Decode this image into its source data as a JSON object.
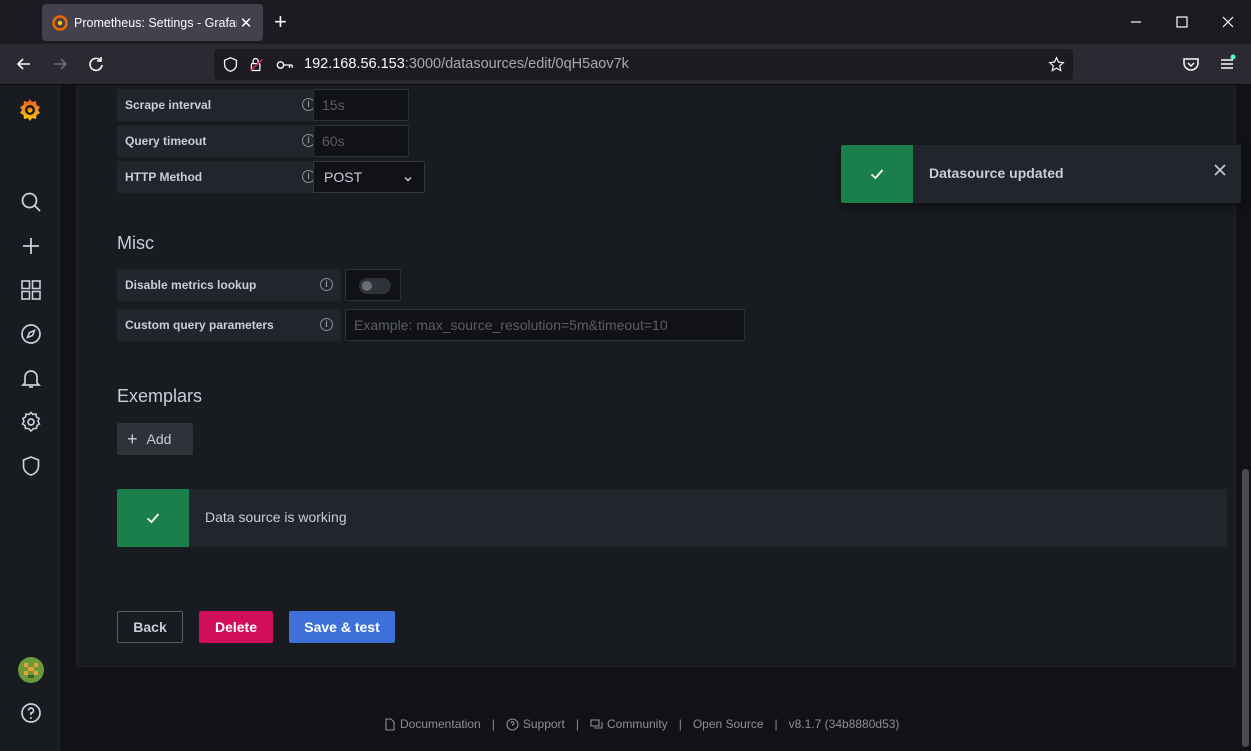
{
  "browser": {
    "tab_title": "Prometheus: Settings - Grafana",
    "url_host": "192.168.56.153",
    "url_rest": ":3000/datasources/edit/0qH5aov7k"
  },
  "http": {
    "scrape_interval_label": "Scrape interval",
    "scrape_interval_placeholder": "15s",
    "query_timeout_label": "Query timeout",
    "query_timeout_placeholder": "60s",
    "http_method_label": "HTTP Method",
    "http_method_value": "POST"
  },
  "misc": {
    "title": "Misc",
    "disable_metrics_label": "Disable metrics lookup",
    "disable_metrics_enabled": false,
    "custom_params_label": "Custom query parameters",
    "custom_params_placeholder": "Example: max_source_resolution=5m&timeout=10"
  },
  "exemplars": {
    "title": "Exemplars",
    "add_label": "Add"
  },
  "status_alert": {
    "text": "Data source is working"
  },
  "actions": {
    "back": "Back",
    "delete": "Delete",
    "save_test": "Save & test"
  },
  "toast": {
    "text": "Datasource updated"
  },
  "footer": {
    "documentation": "Documentation",
    "support": "Support",
    "community": "Community",
    "open_source": "Open Source",
    "version": "v8.1.7 (34b8880d53)",
    "separator": "|"
  },
  "colors": {
    "success": "#1a7f4b",
    "delete": "#d10e5c",
    "primary": "#3d71d9",
    "grafana_orange": "#f46800"
  },
  "icons": {
    "sidebar": [
      "grafana-logo-icon",
      "search-icon",
      "plus-icon",
      "dashboards-icon",
      "explore-icon",
      "alerting-icon",
      "gear-icon",
      "shield-icon",
      "avatar",
      "help-icon"
    ]
  }
}
